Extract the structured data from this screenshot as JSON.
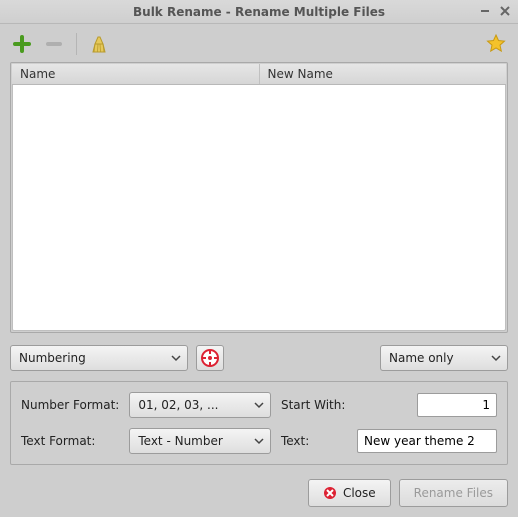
{
  "window": {
    "title": "Bulk Rename - Rename Multiple Files"
  },
  "columns": {
    "name": "Name",
    "new_name": "New Name"
  },
  "mode": {
    "selected": "Numbering"
  },
  "scope": {
    "selected": "Name only"
  },
  "options": {
    "number_format_label": "Number Format:",
    "number_format_value": "01, 02, 03, ...",
    "start_with_label": "Start With:",
    "start_with_value": "1",
    "text_format_label": "Text Format:",
    "text_format_value": "Text - Number",
    "text_label": "Text:",
    "text_value": "New year theme 2"
  },
  "buttons": {
    "close": "Close",
    "rename": "Rename Files"
  }
}
